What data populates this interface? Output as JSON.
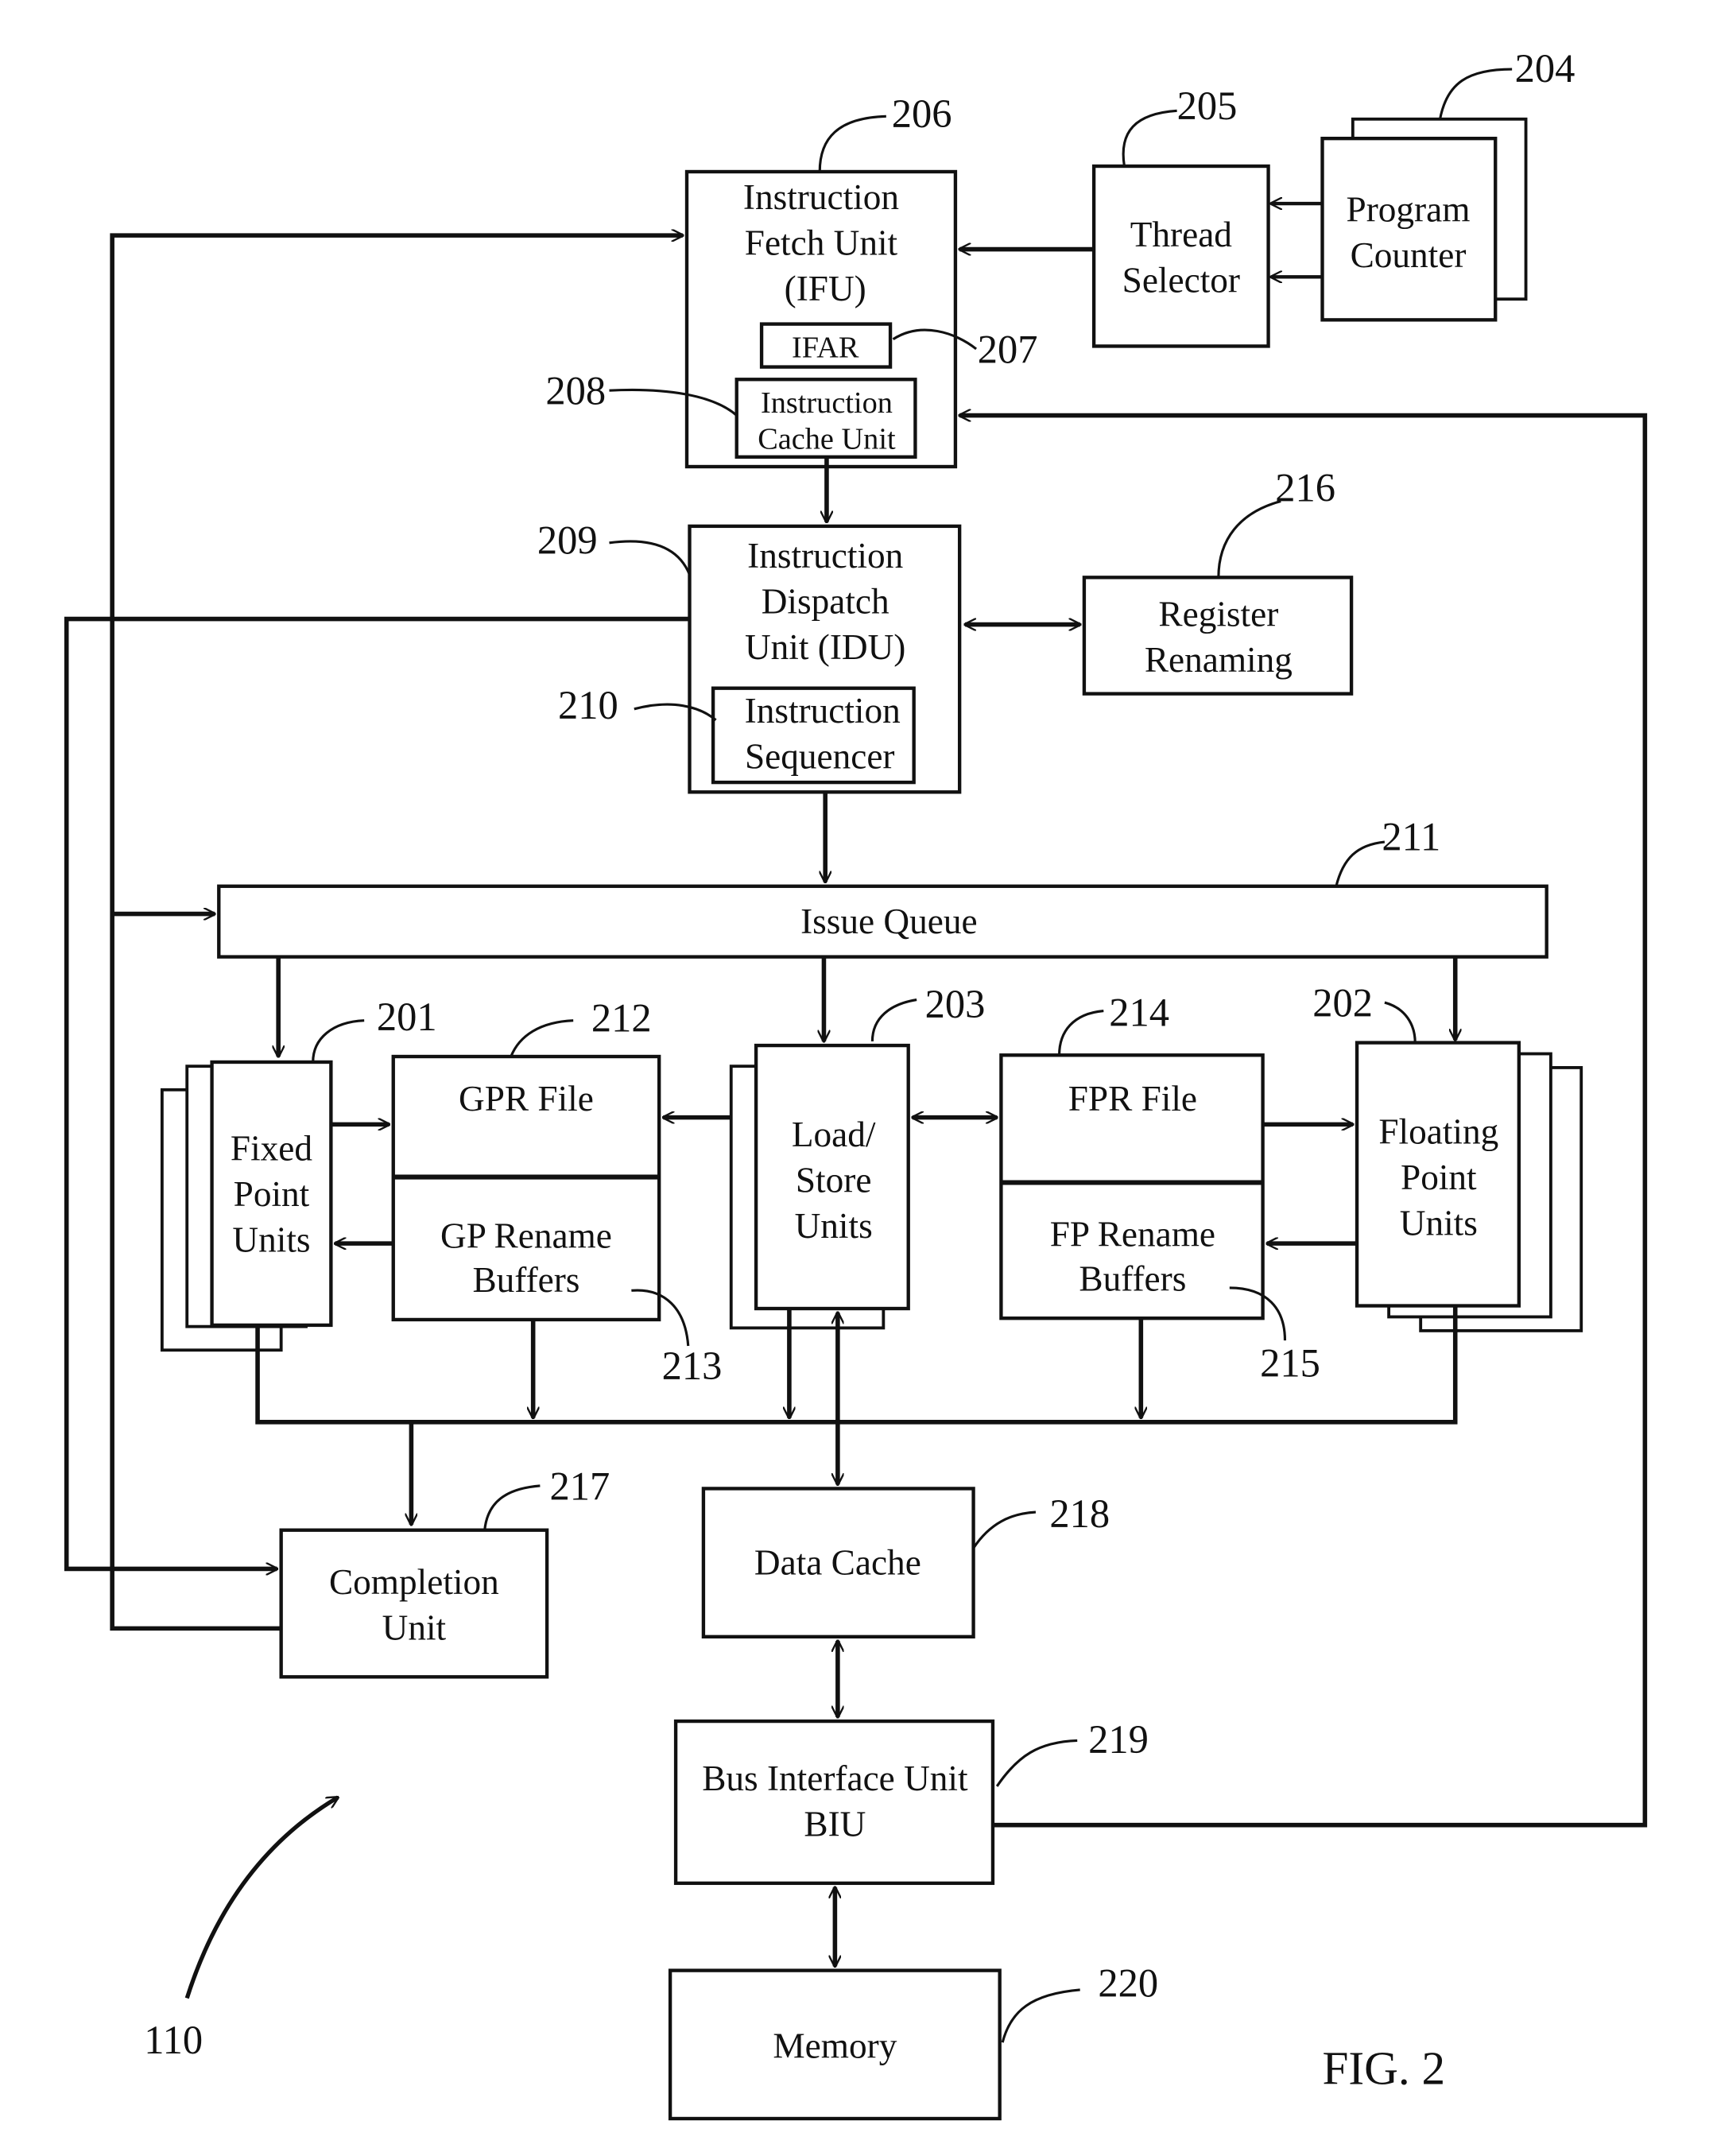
{
  "figure": {
    "caption": "FIG. 2",
    "overall_ref": "110"
  },
  "blocks": {
    "program_counter": {
      "ref": "204",
      "lines": [
        "Program",
        "Counter"
      ]
    },
    "thread_selector": {
      "ref": "205",
      "lines": [
        "Thread",
        "Selector"
      ]
    },
    "ifu": {
      "ref": "206",
      "lines": [
        "Instruction",
        "Fetch Unit",
        "(IFU)"
      ]
    },
    "ifar": {
      "ref": "207",
      "label": "IFAR"
    },
    "icache": {
      "ref": "208",
      "lines": [
        "Instruction",
        "Cache Unit"
      ]
    },
    "idu": {
      "ref": "209",
      "lines": [
        "Instruction",
        "Dispatch",
        "Unit (IDU)"
      ]
    },
    "sequencer": {
      "ref": "210",
      "lines": [
        "Instruction",
        "Sequencer"
      ]
    },
    "register_renaming": {
      "ref": "216",
      "lines": [
        "Register",
        "Renaming"
      ]
    },
    "issue_queue": {
      "ref": "211",
      "label": "Issue Queue"
    },
    "fixed_point": {
      "ref": "201",
      "lines": [
        "Fixed",
        "Point",
        "Units"
      ]
    },
    "gpr_file": {
      "ref": "212",
      "label": "GPR File"
    },
    "gp_rename": {
      "ref": "213",
      "lines": [
        "GP Rename",
        "Buffers"
      ]
    },
    "load_store": {
      "ref": "203",
      "lines": [
        "Load/",
        "Store",
        "Units"
      ]
    },
    "fpr_file": {
      "ref": "214",
      "label": "FPR File"
    },
    "fp_rename": {
      "ref": "215",
      "lines": [
        "FP Rename",
        "Buffers"
      ]
    },
    "floating_point": {
      "ref": "202",
      "lines": [
        "Floating",
        "Point",
        "Units"
      ]
    },
    "completion": {
      "ref": "217",
      "lines": [
        "Completion",
        "Unit"
      ]
    },
    "data_cache": {
      "ref": "218",
      "label": "Data Cache"
    },
    "biu": {
      "ref": "219",
      "lines": [
        "Bus Interface Unit",
        "BIU"
      ]
    },
    "memory": {
      "ref": "220",
      "label": "Memory"
    }
  }
}
